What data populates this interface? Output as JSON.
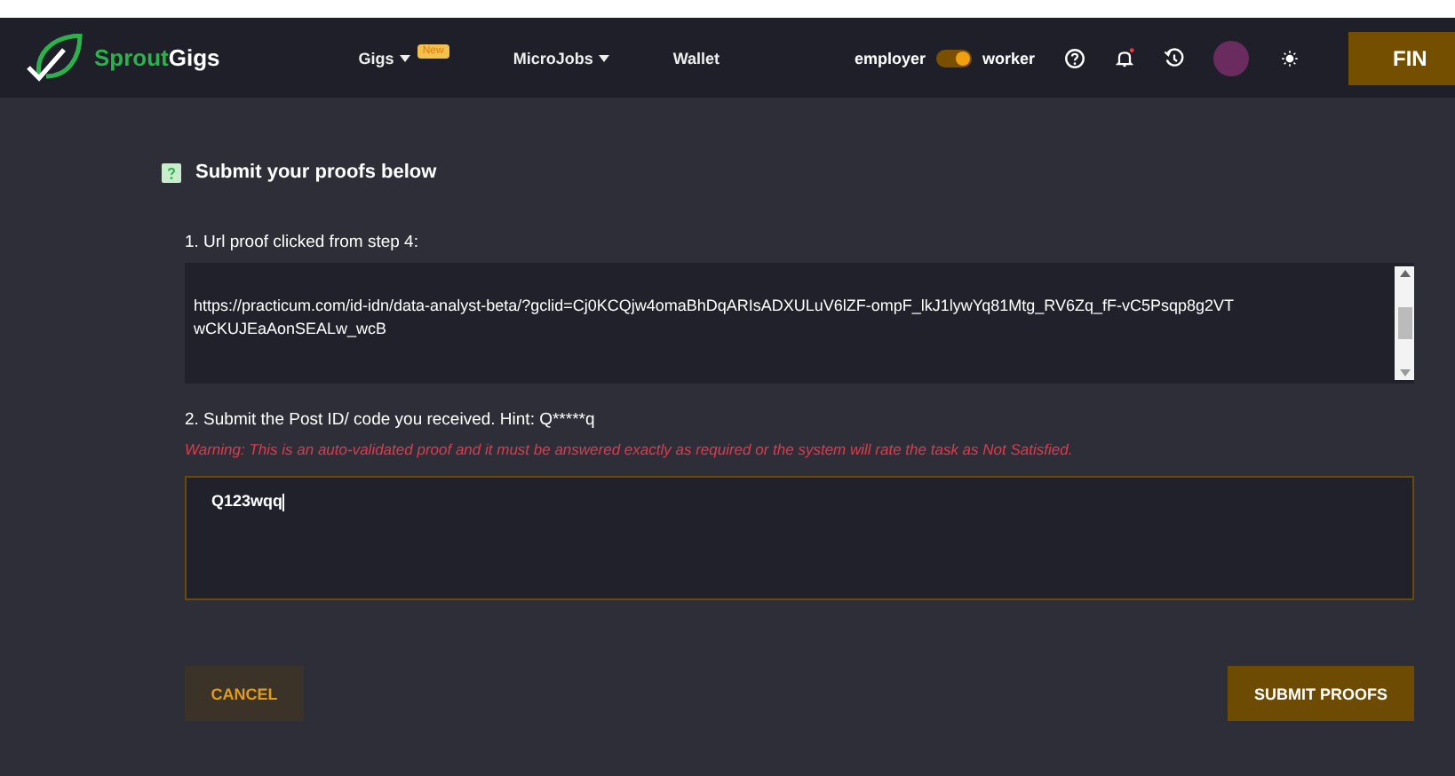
{
  "nav": {
    "brand_first": "Sprout",
    "brand_second": "Gigs",
    "menu": [
      {
        "label": "Gigs",
        "dropdown": true,
        "badge": "New"
      },
      {
        "label": "MicroJobs",
        "dropdown": true
      },
      {
        "label": "Wallet",
        "dropdown": false
      }
    ],
    "role_toggle": {
      "left": "employer",
      "right": "worker",
      "on": true
    },
    "notifications_unread": true,
    "cta": "FIN"
  },
  "form": {
    "heading": "Submit your proofs below",
    "questions": [
      {
        "kind": "textarea",
        "label": "1. Url proof clicked from step 4:",
        "value": "https://practicum.com/id-idn/data-analyst-beta/?gclid=Cj0KCQjw4omaBhDqARIsADXULuV6lZF-ompF_lkJ1lywYq81Mtg_RV6Zq_fF-vC5Psqp8g2VTwCKUJEaAonSEALw_wcB"
      },
      {
        "kind": "code",
        "label": "2. Submit the Post ID/ code you received. Hint: Q*****q",
        "warning": "Warning: This is an auto-validated proof and it must be answered exactly as required or the system will rate the task as Not Satisfied.",
        "value": "Q123wqq"
      }
    ],
    "cancel": "CANCEL",
    "submit": "SUBMIT PROOFS"
  }
}
